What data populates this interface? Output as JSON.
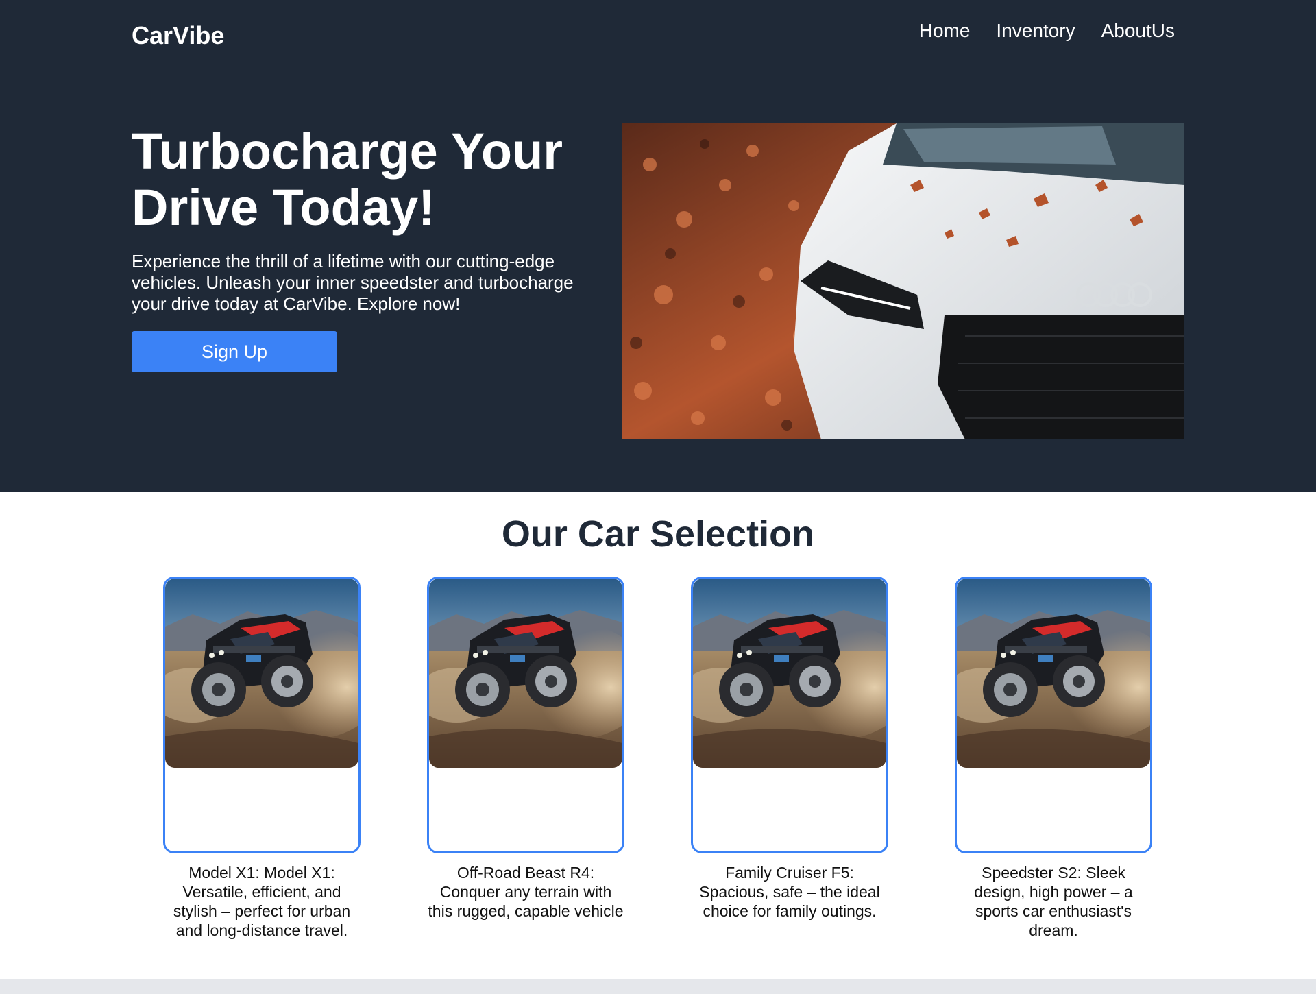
{
  "header": {
    "brand": "CarVibe",
    "nav": [
      "Home",
      "Inventory",
      "AboutUs"
    ]
  },
  "hero": {
    "title": "Turbocharge Your Drive Today!",
    "text": "Experience the thrill of a lifetime with our cutting-edge vehicles. Unleash your inner speedster and turbocharge your drive today at CarVibe. Explore now!",
    "cta_label": "Sign Up",
    "image": "white-sports-car-with-autumn-leaves"
  },
  "selection": {
    "title": "Our Car Selection",
    "cards": [
      {
        "image": "offroad-buggy",
        "caption": "Model X1: Model X1: Versatile, efficient, and stylish – perfect for urban and long-distance travel."
      },
      {
        "image": "offroad-buggy",
        "caption": "Off-Road Beast R4: Conquer any terrain with this rugged, capable vehicle"
      },
      {
        "image": "offroad-buggy",
        "caption": "Family Cruiser F5: Spacious, safe – the ideal choice for family outings."
      },
      {
        "image": "offroad-buggy",
        "caption": "Speedster S2: Sleek design, high power – a sports car enthusiast's dream."
      }
    ]
  },
  "colors": {
    "header_bg": "#1f2937",
    "accent": "#3b82f6",
    "text_dark": "#1f2937",
    "footer_strip": "#e5e7eb"
  }
}
